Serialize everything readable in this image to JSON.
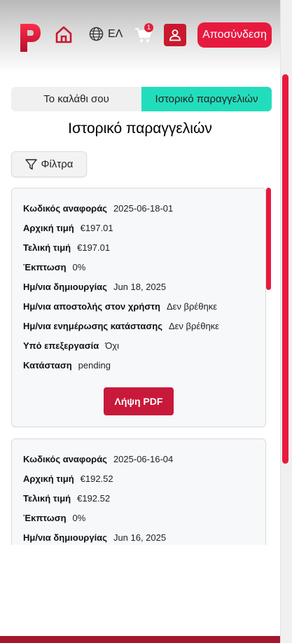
{
  "header": {
    "logo_icon": "brand-p-logo",
    "home_icon": "home-icon",
    "language": {
      "icon": "globe-icon",
      "label": "ΕΛ"
    },
    "cart": {
      "icon": "cart-icon",
      "badge": "1"
    },
    "user_icon": "user-icon",
    "logout_label": "Αποσύνδεση"
  },
  "tabs": [
    {
      "label": "Το καλάθι σου",
      "active": false
    },
    {
      "label": "Ιστορικό παραγγελιών",
      "active": true
    }
  ],
  "page_title": "Ιστορικό παραγγελιών",
  "filter": {
    "icon": "filter-icon",
    "label": "Φίλτρα"
  },
  "orders": [
    {
      "rows": [
        {
          "label": "Κωδικός αναφοράς",
          "value": "2025-06-18-01"
        },
        {
          "label": "Αρχική τιμή",
          "value": "€197.01"
        },
        {
          "label": "Τελική τιμή",
          "value": "€197.01"
        },
        {
          "label": "Έκπτωση",
          "value": "0%"
        },
        {
          "label": "Ημ/νια δημιουργίας",
          "value": "Jun 18, 2025"
        },
        {
          "label": "Ημ/νια αποστολής στον χρήστη",
          "value": "Δεν βρέθηκε"
        },
        {
          "label": "Ημ/νια ενημέρωσης κατάστασης",
          "value": "Δεν βρέθηκε"
        },
        {
          "label": "Υπό επεξεργασία",
          "value": "Όχι"
        },
        {
          "label": "Κατάσταση",
          "value": "pending"
        }
      ],
      "pdf_label": "Λήψη PDF"
    },
    {
      "rows": [
        {
          "label": "Κωδικός αναφοράς",
          "value": "2025-06-16-04"
        },
        {
          "label": "Αρχική τιμή",
          "value": "€192.52"
        },
        {
          "label": "Τελική τιμή",
          "value": "€192.52"
        },
        {
          "label": "Έκπτωση",
          "value": "0%"
        },
        {
          "label": "Ημ/νια δημιουργίας",
          "value": "Jun 16, 2025"
        }
      ]
    }
  ],
  "colors": {
    "brand_red": "#e8193f",
    "dark_red": "#c8192f",
    "active_tab": "#22ddbc"
  }
}
